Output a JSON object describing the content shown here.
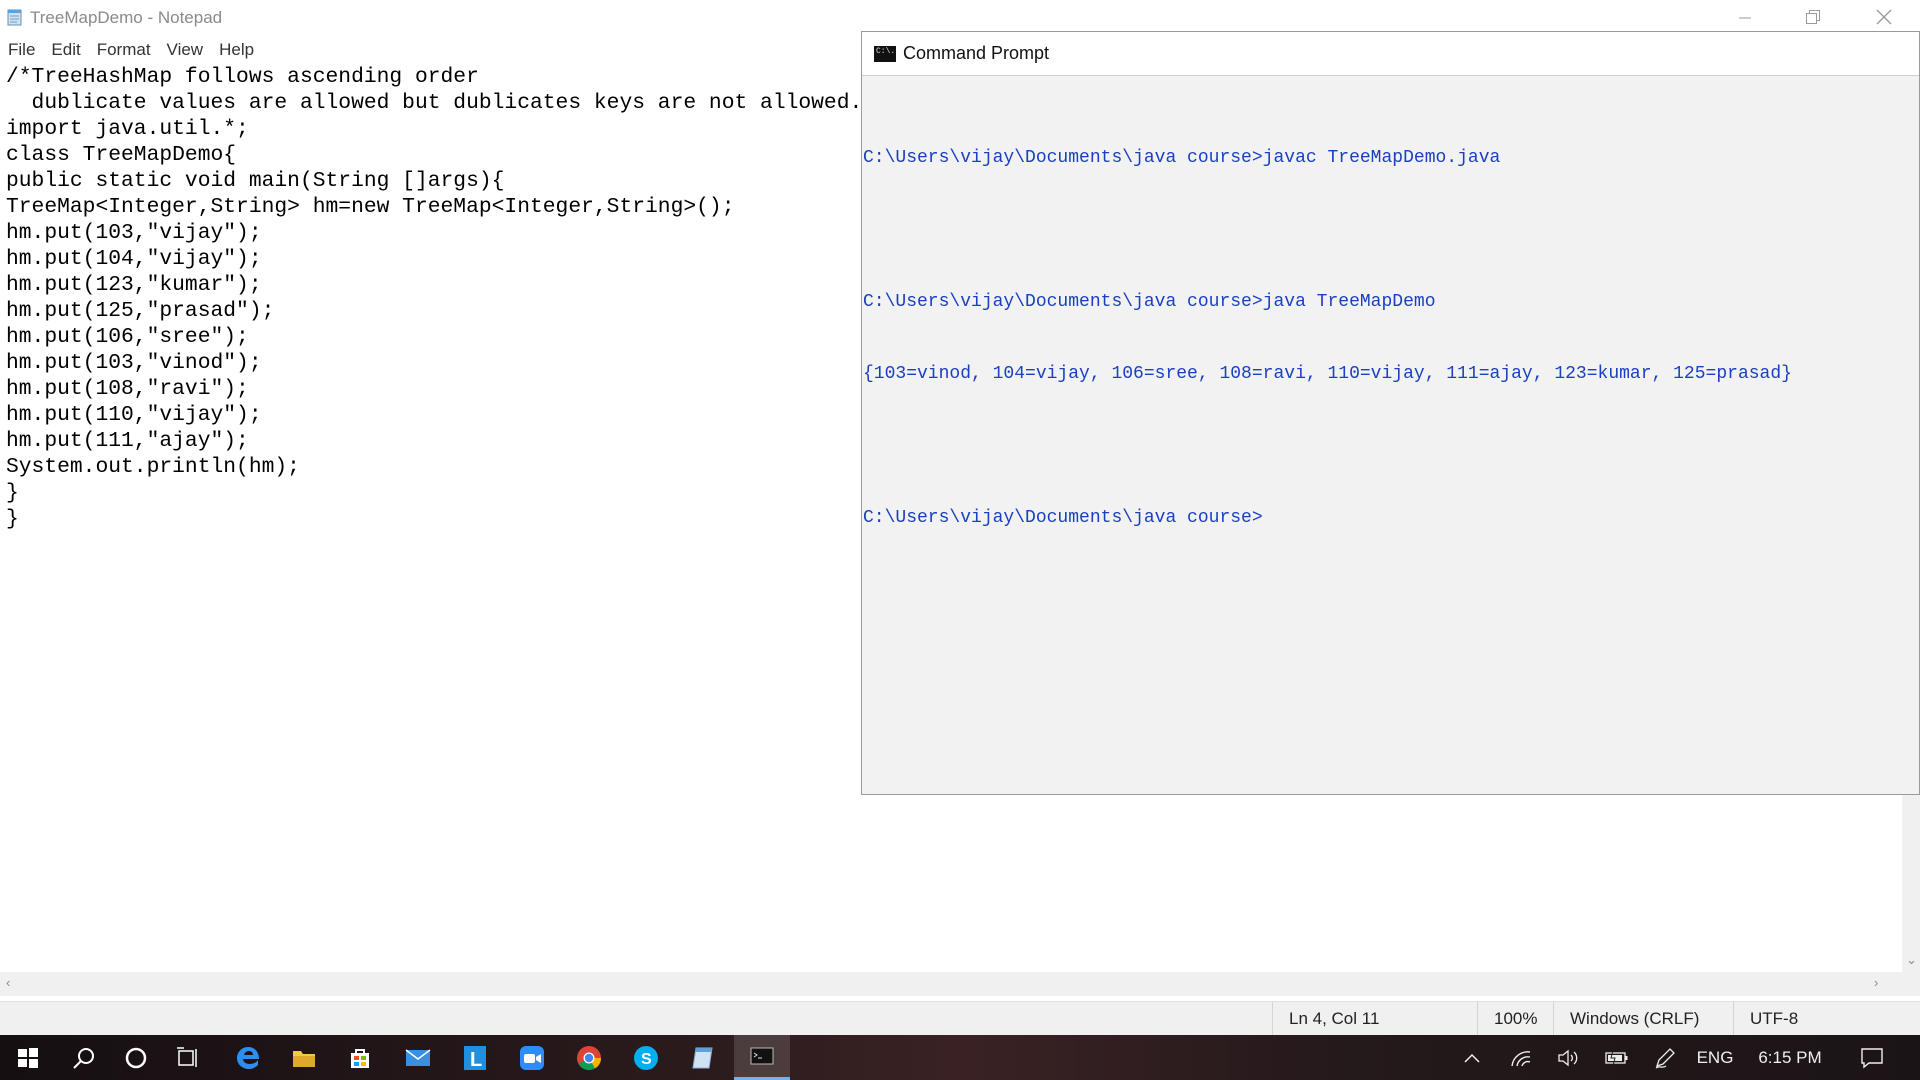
{
  "notepad": {
    "title": "TreeMapDemo - Notepad",
    "menu": [
      "File",
      "Edit",
      "Format",
      "View",
      "Help"
    ],
    "code_lines": [
      "/*TreeHashMap follows ascending order",
      "  dublicate values are allowed but dublicates keys are not allowed.*/",
      "import java.util.*;",
      "class TreeMapDemo{",
      "public static void main(String []args){",
      "TreeMap<Integer,String> hm=new TreeMap<Integer,String>();",
      "hm.put(103,\"vijay\");",
      "hm.put(104,\"vijay\");",
      "hm.put(123,\"kumar\");",
      "hm.put(125,\"prasad\");",
      "hm.put(106,\"sree\");",
      "hm.put(103,\"vinod\");",
      "hm.put(108,\"ravi\");",
      "hm.put(110,\"vijay\");",
      "hm.put(111,\"ajay\");",
      "System.out.println(hm);",
      "}",
      "}"
    ],
    "status": {
      "position": "Ln 4, Col 11",
      "zoom": "100%",
      "line_ending": "Windows (CRLF)",
      "encoding": "UTF-8"
    }
  },
  "cmd": {
    "title": "Command Prompt",
    "icon_text": "C:\\.",
    "lines": [
      "",
      "C:\\Users\\vijay\\Documents\\java course>javac TreeMapDemo.java",
      "",
      "C:\\Users\\vijay\\Documents\\java course>java TreeMapDemo",
      "{103=vinod, 104=vijay, 106=sree, 108=ravi, 110=vijay, 111=ajay, 123=kumar, 125=prasad}",
      "",
      "C:\\Users\\vijay\\Documents\\java course>"
    ],
    "text_color": "#1a3fc0"
  },
  "taskbar": {
    "apps": [
      "windows-start-icon",
      "search-icon",
      "cortana-icon",
      "task-view-icon",
      "edge-icon",
      "file-explorer-icon",
      "store-icon",
      "mail-icon",
      "l-app-icon",
      "zoom-icon",
      "chrome-icon",
      "skype-icon",
      "notepad-icon",
      "command-prompt-icon"
    ],
    "language": "ENG",
    "time": "6:15 PM"
  }
}
